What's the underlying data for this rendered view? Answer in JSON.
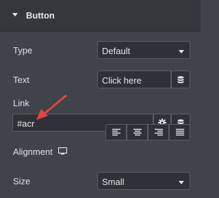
{
  "section": {
    "title": "Button"
  },
  "type": {
    "label": "Type",
    "value": "Default"
  },
  "text": {
    "label": "Text",
    "value": "Click here"
  },
  "link": {
    "label": "Link",
    "value": "#acr"
  },
  "alignment": {
    "label": "Alignment",
    "options": [
      "align-left",
      "align-center",
      "align-right",
      "justify"
    ]
  },
  "size": {
    "label": "Size",
    "value": "Small"
  },
  "colors": {
    "panel_bg": "#404349",
    "header_bg": "#34383c",
    "input_bg": "#2e3136",
    "border": "#5a5e64",
    "annotation_arrow": "#e8453c"
  },
  "icons": [
    "caret-down-icon",
    "database-icon",
    "gear-icon",
    "monitor-icon",
    "align-left-icon",
    "align-center-icon",
    "align-right-icon",
    "justify-icon"
  ]
}
